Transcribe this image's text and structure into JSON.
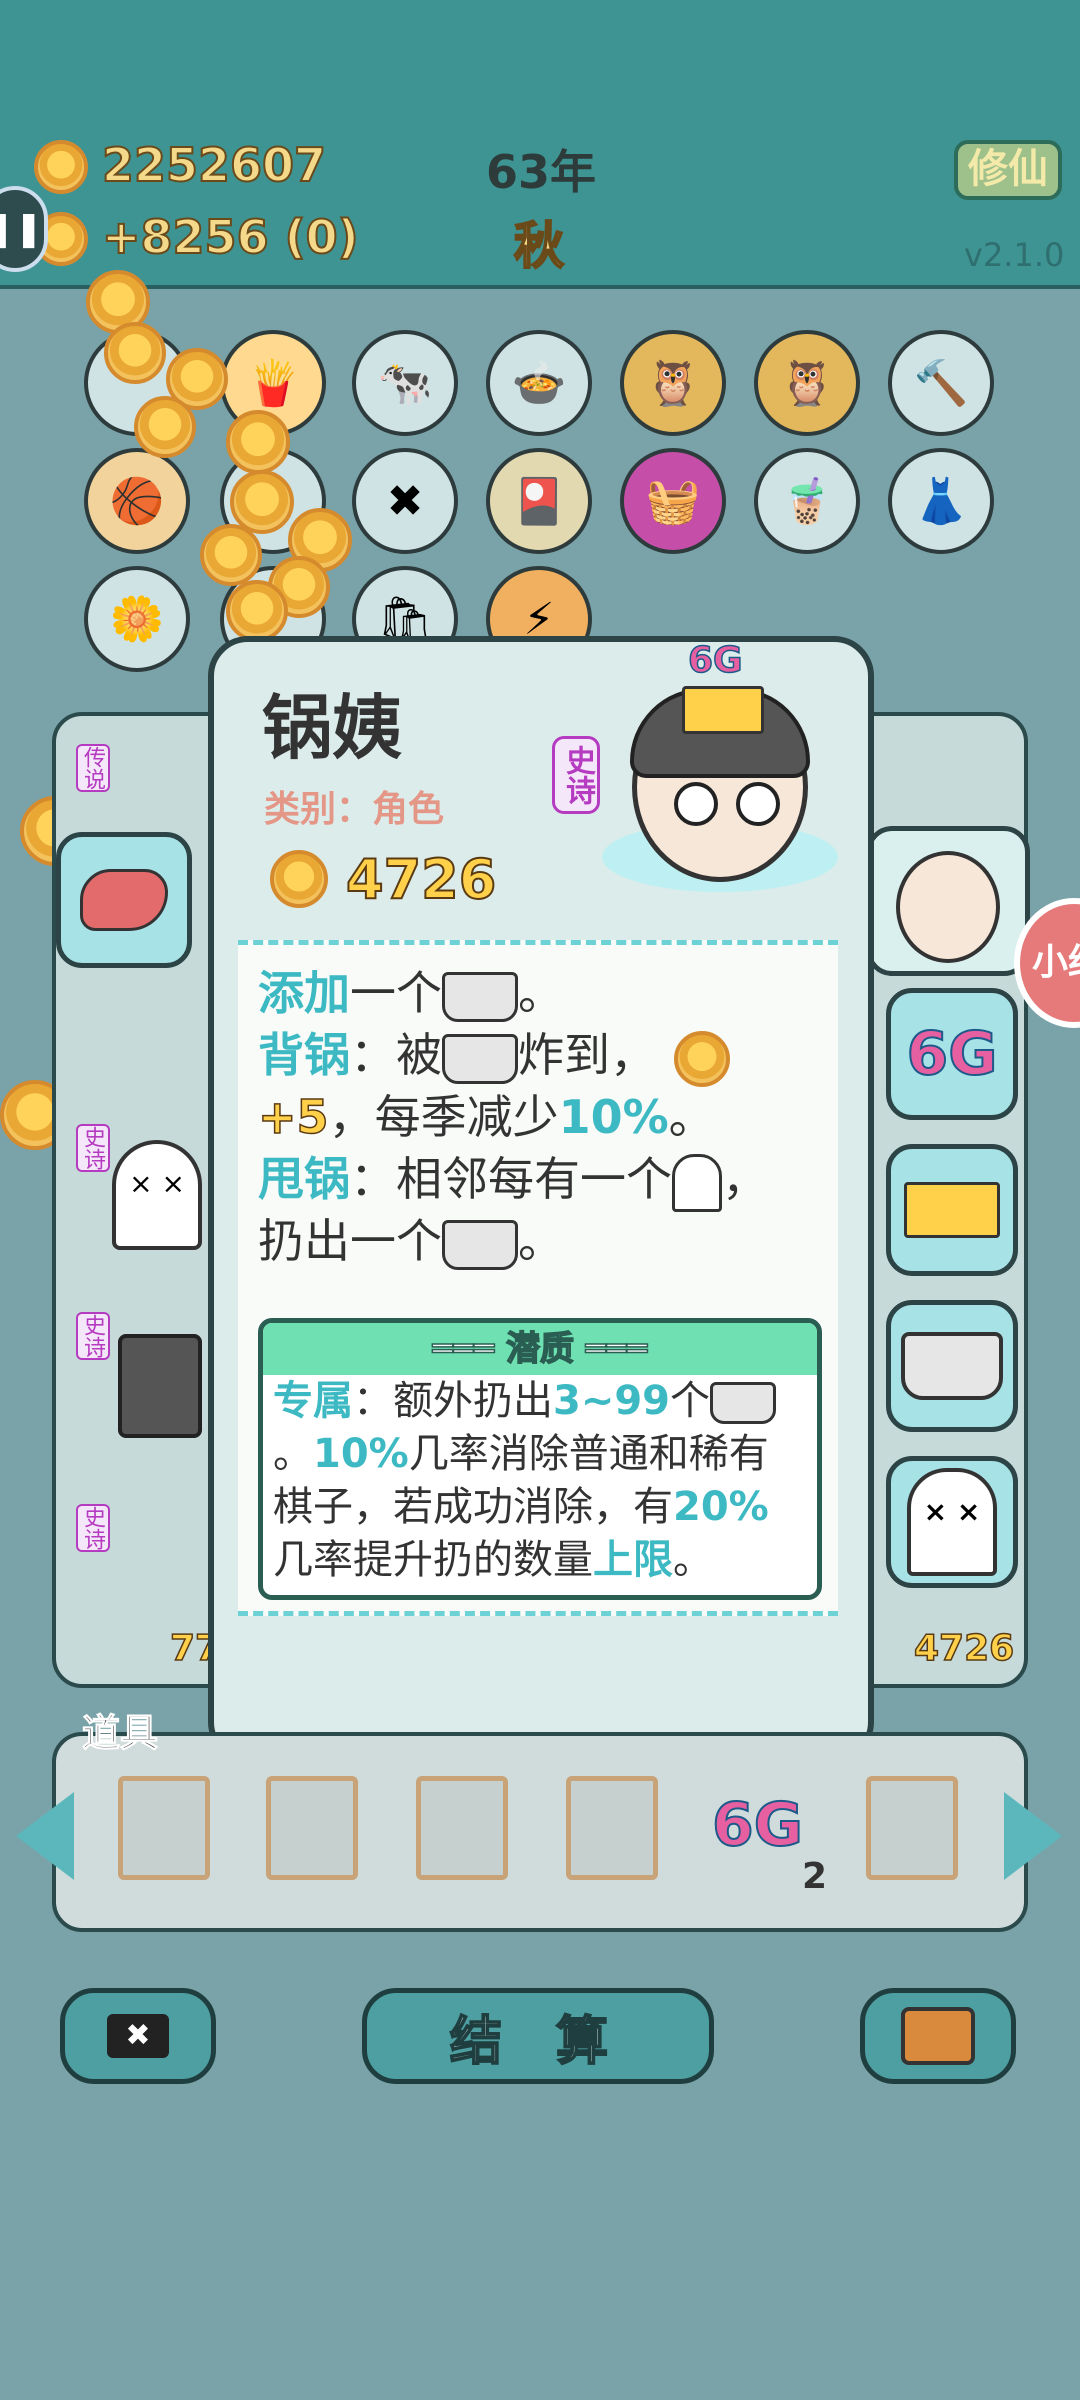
{
  "header": {
    "coins": "2252607",
    "income": "+8256 (0)",
    "year": "63年",
    "season": "秋",
    "xiuxian_label": "修仙",
    "version": "v2.1.0"
  },
  "board": {
    "row1": [
      "",
      "fries-icon",
      "cows-icon",
      "duck-pot-icon",
      "owls-icon",
      "owls-icon",
      "hammer-icon"
    ],
    "row2": [
      "basketballs-icon",
      "",
      "delete-tag-icon",
      "pokeball-pack-icon",
      "basket-icon",
      "milk-tea-icon",
      "skirt-icon"
    ],
    "row3": [
      "flower-pot-icon",
      "",
      "bag-icon",
      "lightning-icon"
    ]
  },
  "side_labels": [
    "传说",
    "史诗",
    "史诗",
    "史诗"
  ],
  "partial_numbers": {
    "left": "77",
    "right": "4726"
  },
  "card": {
    "name": "锅姨",
    "category": "类别：角色",
    "price": "4726",
    "rarity": "史诗",
    "crown_label": "6G",
    "lines": {
      "l1_kw": "添加",
      "l1_rest": "一个",
      "l1_end": "。",
      "l2_kw": "背锅",
      "l2_a": "：被",
      "l2_b": "炸到，",
      "l3_plus": "+5",
      "l3_mid": "，每季减少",
      "l3_pct": "10%",
      "l3_end": "。",
      "l4_kw": "甩锅",
      "l4_a": "：相邻每有一个",
      "l4_b": "，",
      "l5_a": "扔出一个",
      "l5_end": "。"
    },
    "potential": {
      "title": "潜质",
      "p1_kw": "专属",
      "p1_a": "：额外扔出",
      "p1_range": "3~99",
      "p1_b": "个",
      "p2_a": "。",
      "p2_pct": "10%",
      "p2_b": "几率消除普通和稀有",
      "p3_a": "棋子，若成功消除，有",
      "p3_pct": "20%",
      "p4_a": "几率提升扔的数量",
      "p4_kw": "上限",
      "p4_end": "。"
    }
  },
  "right_tags": [
    "6G",
    "crown-icon",
    "pressure-cooker-icon",
    "ghost-icon"
  ],
  "right_edge_text": "小红",
  "items": {
    "title": "道具",
    "slot5_label": "6G",
    "slot5_count": "2"
  },
  "buttons": {
    "settle": "结 算"
  },
  "colors": {
    "topbar": "#3e9393",
    "keyword": "#3cb9c2",
    "coin_text": "#ffd04a",
    "rarity_epic": "#b53cc0"
  }
}
